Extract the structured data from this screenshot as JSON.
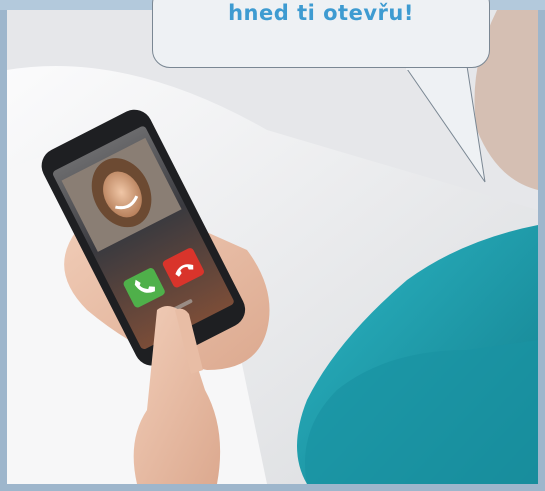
{
  "bubble": {
    "text": "hned ti otevřu!"
  },
  "colors": {
    "frame": "#9eb6cc",
    "text": "#3e9bd1",
    "accept": "#4fb04a",
    "decline": "#d9342b",
    "sweater": "#1f9fae"
  },
  "scene": {
    "image_type": "photo",
    "icons": [
      "phone-accept-icon",
      "phone-decline-icon"
    ]
  }
}
